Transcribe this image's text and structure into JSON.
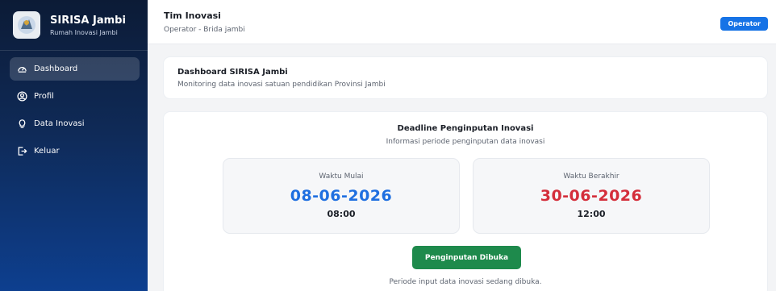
{
  "sidebar": {
    "brand_title": "SIRISA Jambi",
    "brand_subtitle": "Rumah Inovasi Jambi",
    "items": [
      {
        "label": "Dashboard",
        "icon": "gauge-icon",
        "active": true
      },
      {
        "label": "Profil",
        "icon": "user-circle-icon",
        "active": false
      },
      {
        "label": "Data Inovasi",
        "icon": "lightbulb-icon",
        "active": false
      },
      {
        "label": "Keluar",
        "icon": "logout-icon",
        "active": false
      }
    ]
  },
  "header": {
    "title": "Tim Inovasi",
    "subtitle": "Operator - Brida jambi",
    "role_badge": "Operator"
  },
  "dashboard_card": {
    "title": "Dashboard SIRISA Jambi",
    "subtitle": "Monitoring data inovasi satuan pendidikan Provinsi Jambi"
  },
  "deadline": {
    "title": "Deadline Penginputan Inovasi",
    "subtitle": "Informasi periode penginputan data inovasi",
    "start": {
      "label": "Waktu Mulai",
      "date": "08-06-2026",
      "time": "08:00"
    },
    "end": {
      "label": "Waktu Berakhir",
      "date": "30-06-2026",
      "time": "12:00"
    },
    "status_button": "Penginputan Dibuka",
    "status_note": "Periode input data inovasi sedang dibuka."
  },
  "colors": {
    "primary": "#1673e6",
    "start_date": "#1f6fe0",
    "end_date": "#d42e3b",
    "open_status": "#1e8a4c",
    "sidebar_dark": "#0c1b36"
  }
}
